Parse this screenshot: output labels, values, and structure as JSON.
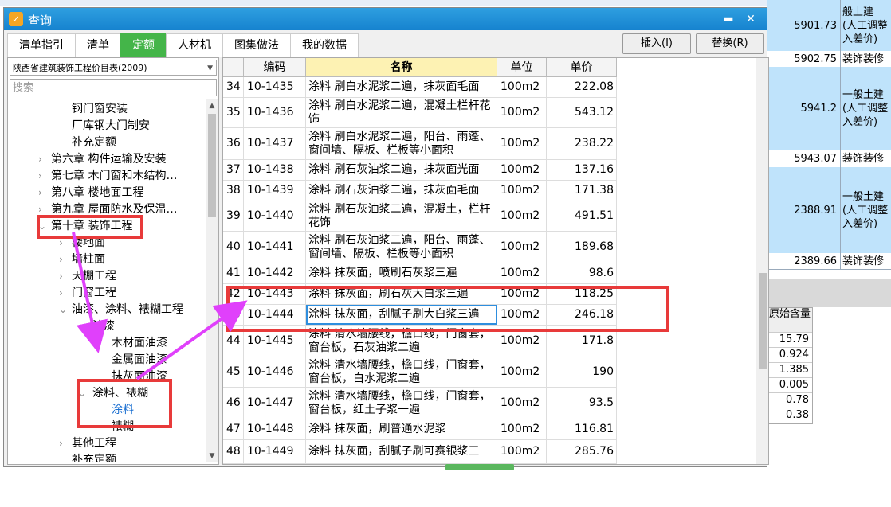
{
  "dialog": {
    "title": "查询",
    "minimize": "▬",
    "close": "✕"
  },
  "tabs": [
    "清单指引",
    "清单",
    "定额",
    "人材机",
    "图集做法",
    "我的数据"
  ],
  "actions": {
    "insert": "插入(I)",
    "replace": "替换(R)"
  },
  "left": {
    "combo": "陕西省建筑装饰工程价目表(2009)",
    "search_placeholder": "搜索",
    "tree": [
      {
        "label": "钢门窗安装"
      },
      {
        "label": "厂库钢大门制安"
      },
      {
        "label": "补充定额"
      },
      {
        "label": "第六章  构件运输及安装"
      },
      {
        "label": "第七章  木门窗和木结构…"
      },
      {
        "label": "第八章  楼地面工程"
      },
      {
        "label": "第九章  屋面防水及保温…"
      },
      {
        "label": "第十章  装饰工程"
      },
      {
        "label": "楼地面"
      },
      {
        "label": "墙柱面"
      },
      {
        "label": "天棚工程"
      },
      {
        "label": "门窗工程"
      },
      {
        "label": "油漆、涂料、裱糊工程"
      },
      {
        "label": "油漆"
      },
      {
        "label": "木材面油漆"
      },
      {
        "label": "金属面油漆"
      },
      {
        "label": "抹灰面油漆"
      },
      {
        "label": "涂料、裱糊"
      },
      {
        "label": "涂料"
      },
      {
        "label": "裱糊"
      },
      {
        "label": "其他工程"
      },
      {
        "label": "补充定额"
      }
    ]
  },
  "grid": {
    "headers": [
      "",
      "编码",
      "名称",
      "单位",
      "单价"
    ],
    "rows": [
      {
        "no": "34",
        "code": "10-1435",
        "name": "涂料  刷白水泥浆二遍，抹灰面毛面",
        "unit": "100m2",
        "price": "222.08"
      },
      {
        "no": "35",
        "code": "10-1436",
        "name": "涂料  刷白水泥浆二遍，混凝土栏杆花饰",
        "unit": "100m2",
        "price": "543.12"
      },
      {
        "no": "36",
        "code": "10-1437",
        "name": "涂料  刷白水泥浆二遍，阳台、雨蓬、窗间墙、隔板、栏板等小面积",
        "unit": "100m2",
        "price": "238.22"
      },
      {
        "no": "37",
        "code": "10-1438",
        "name": "涂料  刷石灰油浆二遍，抹灰面光面",
        "unit": "100m2",
        "price": "137.16"
      },
      {
        "no": "38",
        "code": "10-1439",
        "name": "涂料  刷石灰油浆二遍，抹灰面毛面",
        "unit": "100m2",
        "price": "171.38"
      },
      {
        "no": "39",
        "code": "10-1440",
        "name": "涂料  刷石灰油浆二遍，混凝土，栏杆花饰",
        "unit": "100m2",
        "price": "491.51"
      },
      {
        "no": "40",
        "code": "10-1441",
        "name": "涂料  刷石灰油浆二遍，阳台、雨蓬、窗间墙、隔板、栏板等小面积",
        "unit": "100m2",
        "price": "189.68"
      },
      {
        "no": "41",
        "code": "10-1442",
        "name": "涂料  抹灰面，喷刷石灰浆三遍",
        "unit": "100m2",
        "price": "98.6"
      },
      {
        "no": "42",
        "code": "10-1443",
        "name": "涂料  抹灰面，刷石灰大白浆三遍",
        "unit": "100m2",
        "price": "118.25"
      },
      {
        "no": "43",
        "code": "10-1444",
        "name": "涂料  抹灰面，刮腻子刷大白浆三遍",
        "unit": "100m2",
        "price": "246.18"
      },
      {
        "no": "44",
        "code": "10-1445",
        "name": "涂料  清水墙腰线，檐口线，门窗套，窗台板，石灰油浆二遍",
        "unit": "100m2",
        "price": "171.8"
      },
      {
        "no": "45",
        "code": "10-1446",
        "name": "涂料  清水墙腰线，檐口线，门窗套，窗台板，白水泥浆二遍",
        "unit": "100m2",
        "price": "190"
      },
      {
        "no": "46",
        "code": "10-1447",
        "name": "涂料  清水墙腰线，檐口线，门窗套，窗台板，红土子浆一遍",
        "unit": "100m2",
        "price": "93.5"
      },
      {
        "no": "47",
        "code": "10-1448",
        "name": "涂料  抹灰面，刷普通水泥浆",
        "unit": "100m2",
        "price": "116.81"
      },
      {
        "no": "48",
        "code": "10-1449",
        "name": "涂料  抹灰面，刮腻子刷可赛银浆三",
        "unit": "100m2",
        "price": "285.76"
      }
    ]
  },
  "background": {
    "rows": [
      {
        "value": "5901.73",
        "text": "般土建 (人工调整 入差价)"
      },
      {
        "value": "5902.75",
        "text": "装饰装修"
      },
      {
        "value": "5941.2",
        "text": "一般土建 (人工调整 入差价)"
      },
      {
        "value": "5943.07",
        "text": "装饰装修"
      },
      {
        "value": "2388.91",
        "text": "一般土建 (人工调整 入差价)"
      },
      {
        "value": "2389.66",
        "text": "装饰装修"
      }
    ],
    "table_header": "原始含量",
    "table_values": [
      "15.79",
      "0.924",
      "1.385",
      "0.005",
      "0.78",
      "0.38"
    ]
  }
}
